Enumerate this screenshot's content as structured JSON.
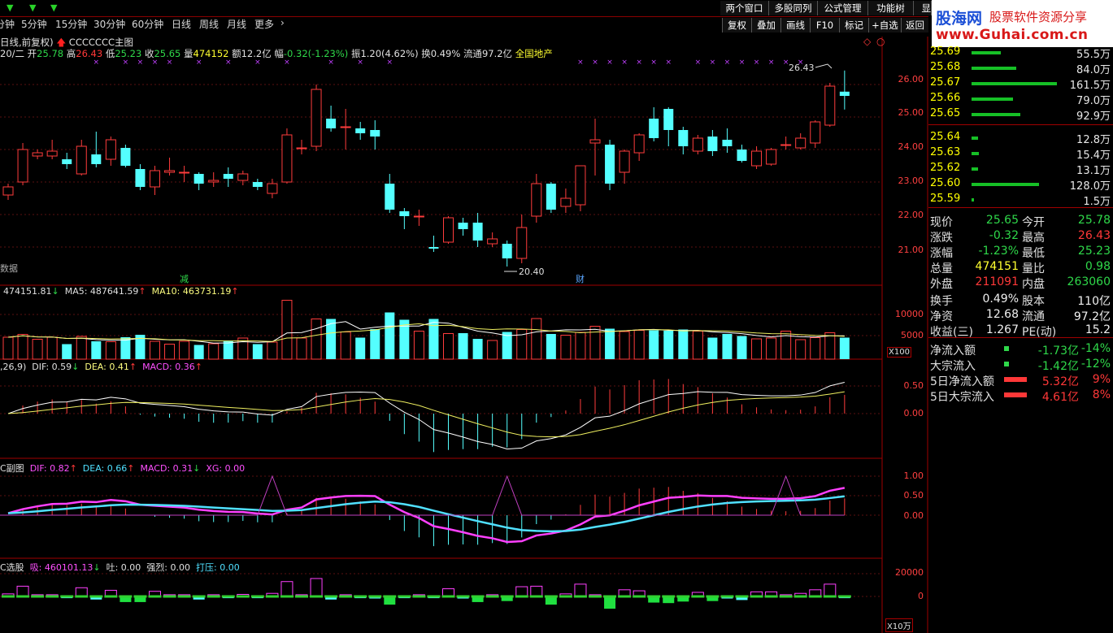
{
  "toolbar": {
    "timeframes": [
      "分钟",
      "5分钟",
      "15分钟",
      "30分钟",
      "60分钟",
      "日线",
      "周线",
      "月线",
      "更多"
    ],
    "top_buttons": [
      "两个窗口",
      "多股同列",
      "公式管理",
      "功能树",
      "显"
    ],
    "right_buttons": [
      "复权",
      "叠加",
      "画线",
      "F10",
      "标记",
      "+自选",
      "返回"
    ]
  },
  "logo": {
    "title": "股海网",
    "subtitle": "股票软件资源分享",
    "url": "www.Guhai.com.cn"
  },
  "chart_header": {
    "line1_prefix": "日线,前复权)",
    "line1_tag": "CCCCCCC主图",
    "date": "20/二",
    "open_label": "开",
    "open": "25.78",
    "high_label": "高",
    "high": "26.43",
    "low_label": "低",
    "low": "25.23",
    "close_label": "收",
    "close": "25.65",
    "vol_label": "量",
    "vol": "474152",
    "amt_label": "额",
    "amt": "12.2亿",
    "chg_label": "幅",
    "chg": "-0.32(-1.23%)",
    "amp_label": "振",
    "amp": "1.20(4.62%)",
    "turn_label": "换",
    "turn": "0.49%",
    "float_label": "流通",
    "float": "97.2亿",
    "sector": "全国地产"
  },
  "main_labels": {
    "high_mark": "26.43",
    "low_mark": "20.40",
    "data_tag": "数据",
    "sig1": "减",
    "sig2": "财"
  },
  "vol_panel": {
    "vol_text": "474151.81",
    "ma5_text": "MA5: 487641.59",
    "ma10_text": "MA10: 463731.19",
    "unit": "X100"
  },
  "macd_panel": {
    "params": ",26,9)",
    "dif": "DIF: 0.59",
    "dea": "DEA: 0.41",
    "macd": "MACD: 0.36"
  },
  "sub_panel": {
    "title": "C副图",
    "dif": "DIF: 0.82",
    "dea": "DEA: 0.66",
    "macd": "MACD: 0.31",
    "xg": "XG: 0.00"
  },
  "pick_panel": {
    "title": "C选股",
    "xi": "吸: 460101.13",
    "tu": "吐: 0.00",
    "qiang": "强烈: 0.00",
    "daya": "打压: 0.00",
    "unit": "X10万"
  },
  "axes": {
    "price": [
      "26.00",
      "25.00",
      "24.00",
      "23.00",
      "22.00",
      "21.00"
    ],
    "vol": [
      "10000",
      "5000"
    ],
    "macd": [
      "0.50",
      "0.00"
    ],
    "sub": [
      "1.00",
      "0.50",
      "0.00"
    ],
    "pick": [
      "20000",
      "0"
    ]
  },
  "order_book": {
    "asks": [
      {
        "price": "25.69",
        "vol": "55.5万",
        "bar": 0.34
      },
      {
        "price": "25.68",
        "vol": "84.0万",
        "bar": 0.52
      },
      {
        "price": "25.67",
        "vol": "161.5万",
        "bar": 1.0
      },
      {
        "price": "25.66",
        "vol": "79.0万",
        "bar": 0.49
      },
      {
        "price": "25.65",
        "vol": "92.9万",
        "bar": 0.57
      }
    ],
    "bids": [
      {
        "price": "25.64",
        "vol": "12.8万",
        "bar": 0.08
      },
      {
        "price": "25.63",
        "vol": "15.4万",
        "bar": 0.09
      },
      {
        "price": "25.62",
        "vol": "13.1万",
        "bar": 0.08
      },
      {
        "price": "25.60",
        "vol": "128.0万",
        "bar": 0.79
      },
      {
        "price": "25.59",
        "vol": "1.5万",
        "bar": 0.01
      }
    ]
  },
  "stats": [
    {
      "l1": "现价",
      "v1": "25.65",
      "c1": "green",
      "l2": "今开",
      "v2": "25.78",
      "c2": "green"
    },
    {
      "l1": "涨跌",
      "v1": "-0.32",
      "c1": "green",
      "l2": "最高",
      "v2": "26.43",
      "c2": "red"
    },
    {
      "l1": "涨幅",
      "v1": "-1.23%",
      "c1": "green",
      "l2": "最低",
      "v2": "25.23",
      "c2": "green"
    },
    {
      "l1": "总量",
      "v1": "474151",
      "c1": "yel",
      "l2": "量比",
      "v2": "0.98",
      "c2": "green"
    },
    {
      "l1": "外盘",
      "v1": "211091",
      "c1": "red",
      "l2": "内盘",
      "v2": "263060",
      "c2": "green"
    },
    {
      "l1": "换手",
      "v1": "0.49%",
      "c1": "wht",
      "l2": "股本",
      "v2": "110亿",
      "c2": "wht"
    },
    {
      "l1": "净资",
      "v1": "12.68",
      "c1": "wht",
      "l2": "流通",
      "v2": "97.2亿",
      "c2": "wht"
    },
    {
      "l1": "收益(三)",
      "v1": "1.267",
      "c1": "wht",
      "l2": "PE(动)",
      "v2": "15.2",
      "c2": "wht"
    }
  ],
  "flows": [
    {
      "label": "净流入额",
      "value": "-1.73亿",
      "pct": "-14%",
      "sign": "neg"
    },
    {
      "label": "大宗流入",
      "value": "-1.42亿",
      "pct": "-12%",
      "sign": "neg"
    },
    {
      "label": "5日净流入额",
      "value": "5.32亿",
      "pct": "9%",
      "sign": "pos"
    },
    {
      "label": "5日大宗流入",
      "value": "4.61亿",
      "pct": "8%",
      "sign": "pos"
    }
  ],
  "chart_data": {
    "type": "candlestick",
    "ylim": [
      20.2,
      26.6
    ],
    "candles": [
      {
        "o": 22.6,
        "c": 22.85,
        "h": 22.95,
        "l": 22.45
      },
      {
        "o": 23.0,
        "c": 24.0,
        "h": 24.2,
        "l": 22.9
      },
      {
        "o": 23.8,
        "c": 23.9,
        "h": 24.0,
        "l": 23.7
      },
      {
        "o": 23.8,
        "c": 23.95,
        "h": 24.3,
        "l": 23.7
      },
      {
        "o": 23.7,
        "c": 23.55,
        "h": 23.9,
        "l": 23.4
      },
      {
        "o": 23.25,
        "c": 24.1,
        "h": 24.3,
        "l": 23.2
      },
      {
        "o": 23.85,
        "c": 23.55,
        "h": 24.55,
        "l": 23.45
      },
      {
        "o": 23.7,
        "c": 24.3,
        "h": 24.4,
        "l": 23.5
      },
      {
        "o": 24.05,
        "c": 23.5,
        "h": 24.15,
        "l": 23.45
      },
      {
        "o": 23.4,
        "c": 22.85,
        "h": 23.55,
        "l": 22.75
      },
      {
        "o": 22.85,
        "c": 23.35,
        "h": 23.5,
        "l": 22.6
      },
      {
        "o": 23.3,
        "c": 23.35,
        "h": 23.75,
        "l": 23.2
      },
      {
        "o": 23.3,
        "c": 23.3,
        "h": 23.5,
        "l": 23.0
      },
      {
        "o": 23.25,
        "c": 22.95,
        "h": 23.3,
        "l": 22.75
      },
      {
        "o": 23.0,
        "c": 23.05,
        "h": 23.3,
        "l": 22.85
      },
      {
        "o": 23.25,
        "c": 23.1,
        "h": 23.45,
        "l": 22.85
      },
      {
        "o": 23.05,
        "c": 23.25,
        "h": 23.35,
        "l": 22.9
      },
      {
        "o": 23.0,
        "c": 22.85,
        "h": 23.1,
        "l": 22.75
      },
      {
        "o": 22.65,
        "c": 22.95,
        "h": 23.1,
        "l": 22.5
      },
      {
        "o": 23.0,
        "c": 24.45,
        "h": 24.65,
        "l": 22.95
      },
      {
        "o": 24.05,
        "c": 24.05,
        "h": 24.3,
        "l": 23.85
      },
      {
        "o": 24.1,
        "c": 25.85,
        "h": 26.0,
        "l": 23.95
      },
      {
        "o": 24.95,
        "c": 24.65,
        "h": 25.35,
        "l": 24.55
      },
      {
        "o": 24.7,
        "c": 24.7,
        "h": 25.25,
        "l": 24.0
      },
      {
        "o": 24.65,
        "c": 24.5,
        "h": 24.85,
        "l": 24.3
      },
      {
        "o": 24.6,
        "c": 24.4,
        "h": 24.9,
        "l": 24.0
      },
      {
        "o": 22.95,
        "c": 22.15,
        "h": 23.25,
        "l": 22.05
      },
      {
        "o": 22.1,
        "c": 21.95,
        "h": 22.2,
        "l": 21.55
      },
      {
        "o": 21.95,
        "c": 21.95,
        "h": 22.15,
        "l": 21.65
      },
      {
        "o": 21.0,
        "c": 20.95,
        "h": 21.35,
        "l": 20.85
      },
      {
        "o": 21.15,
        "c": 21.9,
        "h": 21.95,
        "l": 21.1
      },
      {
        "o": 21.75,
        "c": 21.55,
        "h": 21.9,
        "l": 21.35
      },
      {
        "o": 21.75,
        "c": 21.2,
        "h": 22.05,
        "l": 21.0
      },
      {
        "o": 21.1,
        "c": 21.25,
        "h": 21.45,
        "l": 21.0
      },
      {
        "o": 21.1,
        "c": 20.65,
        "h": 21.2,
        "l": 20.4
      },
      {
        "o": 20.65,
        "c": 21.6,
        "h": 22.0,
        "l": 20.5
      },
      {
        "o": 21.95,
        "c": 22.95,
        "h": 23.25,
        "l": 21.75
      },
      {
        "o": 22.95,
        "c": 22.15,
        "h": 23.0,
        "l": 22.05
      },
      {
        "o": 22.25,
        "c": 22.5,
        "h": 22.8,
        "l": 22.05
      },
      {
        "o": 22.3,
        "c": 23.5,
        "h": 23.5,
        "l": 22.1
      },
      {
        "o": 24.2,
        "c": 24.3,
        "h": 24.95,
        "l": 23.2
      },
      {
        "o": 24.15,
        "c": 22.95,
        "h": 24.3,
        "l": 22.75
      },
      {
        "o": 23.3,
        "c": 23.95,
        "h": 24.0,
        "l": 22.95
      },
      {
        "o": 23.9,
        "c": 24.45,
        "h": 24.5,
        "l": 23.65
      },
      {
        "o": 24.95,
        "c": 24.35,
        "h": 25.3,
        "l": 24.25
      },
      {
        "o": 25.25,
        "c": 24.6,
        "h": 25.3,
        "l": 24.1
      },
      {
        "o": 24.6,
        "c": 24.1,
        "h": 24.7,
        "l": 23.85
      },
      {
        "o": 23.95,
        "c": 24.35,
        "h": 24.45,
        "l": 23.85
      },
      {
        "o": 24.4,
        "c": 23.95,
        "h": 24.6,
        "l": 23.8
      },
      {
        "o": 24.3,
        "c": 24.1,
        "h": 24.65,
        "l": 23.9
      },
      {
        "o": 24.0,
        "c": 23.65,
        "h": 24.15,
        "l": 23.6
      },
      {
        "o": 23.5,
        "c": 23.95,
        "h": 24.1,
        "l": 23.4
      },
      {
        "o": 23.55,
        "c": 24.0,
        "h": 24.05,
        "l": 23.5
      },
      {
        "o": 24.15,
        "c": 24.15,
        "h": 24.4,
        "l": 24.0
      },
      {
        "o": 24.05,
        "c": 24.35,
        "h": 24.5,
        "l": 24.0
      },
      {
        "o": 24.2,
        "c": 24.85,
        "h": 24.9,
        "l": 24.05
      },
      {
        "o": 24.75,
        "c": 25.95,
        "h": 26.05,
        "l": 24.7
      },
      {
        "o": 25.78,
        "c": 25.65,
        "h": 26.43,
        "l": 25.23
      }
    ],
    "volumes": [
      0.54,
      0.61,
      0.49,
      0.54,
      0.37,
      0.56,
      0.44,
      0.43,
      0.54,
      0.6,
      0.44,
      0.37,
      0.44,
      0.35,
      0.38,
      0.46,
      0.52,
      0.37,
      0.42,
      1.45,
      0.52,
      0.99,
      0.99,
      0.67,
      0.53,
      0.74,
      1.15,
      0.97,
      0.69,
      0.99,
      0.63,
      0.64,
      0.5,
      0.46,
      0.67,
      0.73,
      1.0,
      0.62,
      0.59,
      0.66,
      0.81,
      0.75,
      0.68,
      0.71,
      0.71,
      0.7,
      0.73,
      0.69,
      0.53,
      0.62,
      0.57,
      0.5,
      0.52,
      0.69,
      0.48,
      0.53,
      0.65,
      0.53
    ]
  }
}
